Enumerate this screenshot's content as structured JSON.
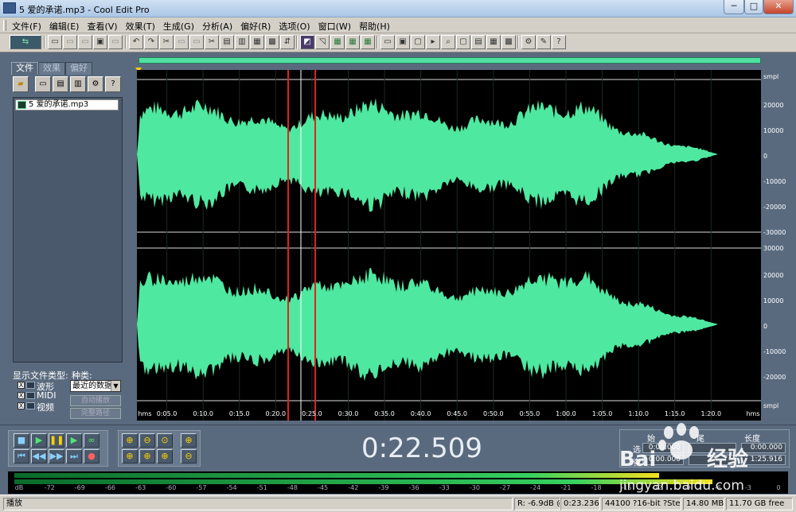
{
  "window": {
    "title": "5 爱的承诺.mp3 - Cool Edit Pro",
    "minimize": "─",
    "maximize": "□",
    "close": "✕"
  },
  "menu": [
    "文件(F)",
    "编辑(E)",
    "查看(V)",
    "效果(T)",
    "生成(G)",
    "分析(A)",
    "偏好(R)",
    "选项(O)",
    "窗口(W)",
    "帮助(H)"
  ],
  "left_panel": {
    "tabs": [
      "文件",
      "效果",
      "偏好"
    ],
    "files": [
      "5 爱的承诺.mp3"
    ],
    "filetype_label": "显示文件类型:",
    "sort_label": "种类:",
    "filetypes": [
      {
        "label": "波形",
        "checked": "X"
      },
      {
        "label": "MIDI",
        "checked": "X"
      },
      {
        "label": "视频",
        "checked": "X"
      }
    ],
    "sort_value": "最近的数据",
    "auto_play": "自动播放",
    "full_path": "完整路径"
  },
  "ruler_labels_top": [
    "smpl",
    "20000",
    "10000",
    "0",
    "-10000",
    "-20000",
    "-30000"
  ],
  "ruler_labels_bottom": [
    "30000",
    "20000",
    "10000",
    "0",
    "-10000",
    "-20000",
    "smpl"
  ],
  "time_labels": [
    "hms",
    "0:05.0",
    "0:10.0",
    "0:15.0",
    "0:20.0",
    "0:25.0",
    "0:30.0",
    "0:35.0",
    "0:40.0",
    "0:45.0",
    "0:50.0",
    "0:55.0",
    "1:00.0",
    "1:05.0",
    "1:10.0",
    "1:15.0",
    "1:20.0",
    "hms"
  ],
  "time_display": "0:22.509",
  "selection": {
    "headers": [
      "始",
      "尾",
      "长度"
    ],
    "rows": [
      {
        "label": "选",
        "begin": "0:00.000",
        "end": "",
        "length": "0:00.000"
      },
      {
        "label": "查",
        "begin": "0:00.000",
        "end": "",
        "length": "1:25.916"
      }
    ]
  },
  "level_labels": [
    "dB",
    "-72",
    "-69",
    "-66",
    "-63",
    "-60",
    "-57",
    "-54",
    "-51",
    "-48",
    "-45",
    "-42",
    "-39",
    "-36",
    "-33",
    "-30",
    "-27",
    "-24",
    "-21",
    "-18",
    "-15",
    "-12",
    "-9",
    "-6",
    "-3",
    "0"
  ],
  "level": {
    "left": 0.84,
    "right": 0.91
  },
  "status": {
    "state": "播放",
    "peak": "R: -6.9dB @",
    "position": "0:23.236",
    "format": "44100 ?16-bit ?Stereo",
    "size": "14.80 MB",
    "free": "11.70 GB free"
  },
  "watermark": {
    "brand": "Bai",
    "brand2": "经验",
    "url": "jingyan.baidu.com"
  },
  "colors": {
    "wave": "#4fe8a0",
    "background": "#000000",
    "highlight": "#e02020"
  }
}
